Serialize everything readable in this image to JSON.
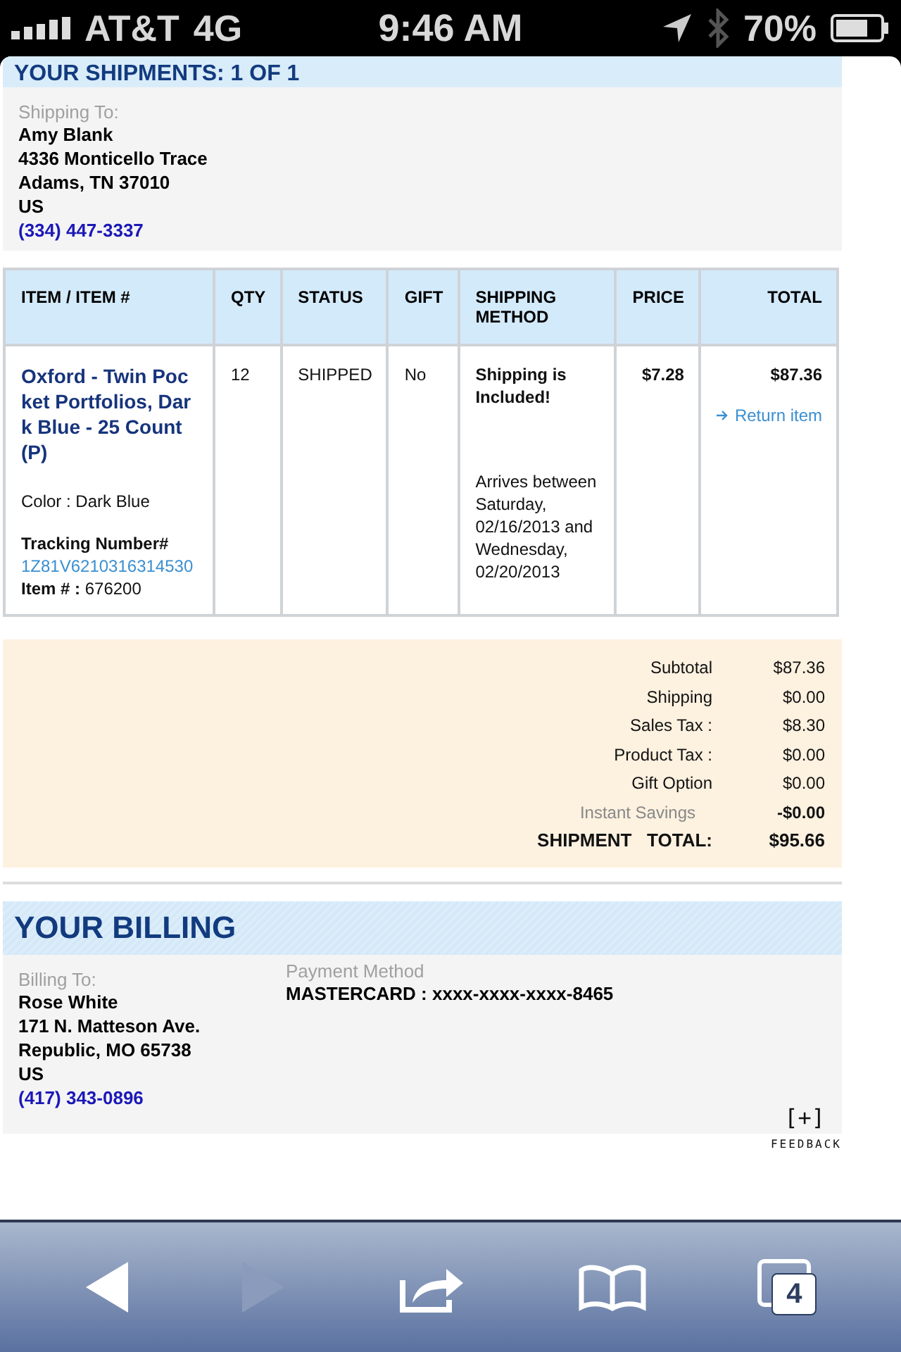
{
  "status_bar": {
    "carrier": "AT&T",
    "network": "4G",
    "time": "9:46 AM",
    "battery": "70%"
  },
  "shipments": {
    "title": "YOUR SHIPMENTS: 1 OF 1",
    "address_label": "Shipping To:",
    "address_lines": [
      "Amy  Blank",
      "4336 Monticello Trace",
      "Adams, TN  37010",
      "US"
    ],
    "phone": "(334) 447-3337"
  },
  "table": {
    "columns": [
      "ITEM / ITEM #",
      "QTY",
      "STATUS",
      "GIFT",
      "SHIPPING METHOD",
      "PRICE",
      "TOTAL"
    ],
    "rows": [
      {
        "item_name": "Oxford - Twin Pocket Portfolios, Dark Blue - 25 Count (P)",
        "color_note": "Color : Dark Blue",
        "tracking_label": "Tracking Number#",
        "tracking_number": "1Z81V6210316314530",
        "item_number": "**Item # :** 676200",
        "qty": "12",
        "status": "SHIPPED",
        "gift": "No",
        "shipping_note": "Shipping is Included!",
        "arrival": "Arrives between Saturday, 02/16/2013 and Wednesday, 02/20/2013",
        "price": "$7.28",
        "total": "$87.36",
        "action": "Return item"
      }
    ]
  },
  "totals": [
    {
      "kind": "normal",
      "label": "Subtotal",
      "value": "$87.36"
    },
    {
      "kind": "normal",
      "label": "Shipping",
      "value": "$0.00"
    },
    {
      "kind": "normal",
      "label": "Sales Tax :",
      "value": "$8.30"
    },
    {
      "kind": "normal",
      "label": "Product Tax :",
      "value": "$0.00"
    },
    {
      "kind": "normal",
      "label": "Gift Option",
      "value": "$0.00"
    },
    {
      "kind": "muted",
      "label": "Instant Savings",
      "value": "-$0.00"
    },
    {
      "kind": "grand",
      "label": "SHIPMENT   TOTAL:",
      "value": "$95.66"
    }
  ],
  "billing": {
    "title": "YOUR BILLING",
    "address_label": "Billing To:",
    "address_lines": [
      "Rose  White",
      "171 N. Matteson Ave.",
      "Republic, MO 65738",
      "US"
    ],
    "phone": "(417) 343-0896",
    "payment_label": "Payment Method",
    "payment": "MASTERCARD : xxxx-xxxx-xxxx-8465",
    "feedback_icon": "[+]",
    "feedback": "FEEDBACK"
  },
  "toolbar": {
    "back_disabled": false,
    "forward_disabled": true,
    "tabs_count": "4"
  }
}
